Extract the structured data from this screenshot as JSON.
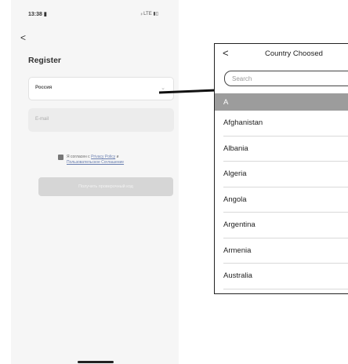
{
  "phone": {
    "status_time": "13:38 ▮",
    "status_icons": "ᵢₗ LTE ▮▯",
    "back_glyph": "<",
    "title": "Register",
    "country_value": "Россия",
    "country_chevron": "⌄",
    "email_placeholder": "E-mail",
    "agree_prefix": "Я согласен с ",
    "agree_privacy": "Privacy Policy",
    "agree_and": " и",
    "agree_terms": "Пользовательское Соглашение",
    "code_button": "Получить проверочный код"
  },
  "picker": {
    "back_glyph": "<",
    "title": "Country Choosed",
    "search_placeholder": "Search",
    "section": "A",
    "countries": [
      "Afghanistan",
      "Albania",
      "Algeria",
      "Angola",
      "Argentina",
      "Armenia",
      "Australia"
    ]
  },
  "colors": {
    "section_bg": "#9c9c9c",
    "button_disabled": "#d6d6d6",
    "link": "#6a7fb0"
  }
}
